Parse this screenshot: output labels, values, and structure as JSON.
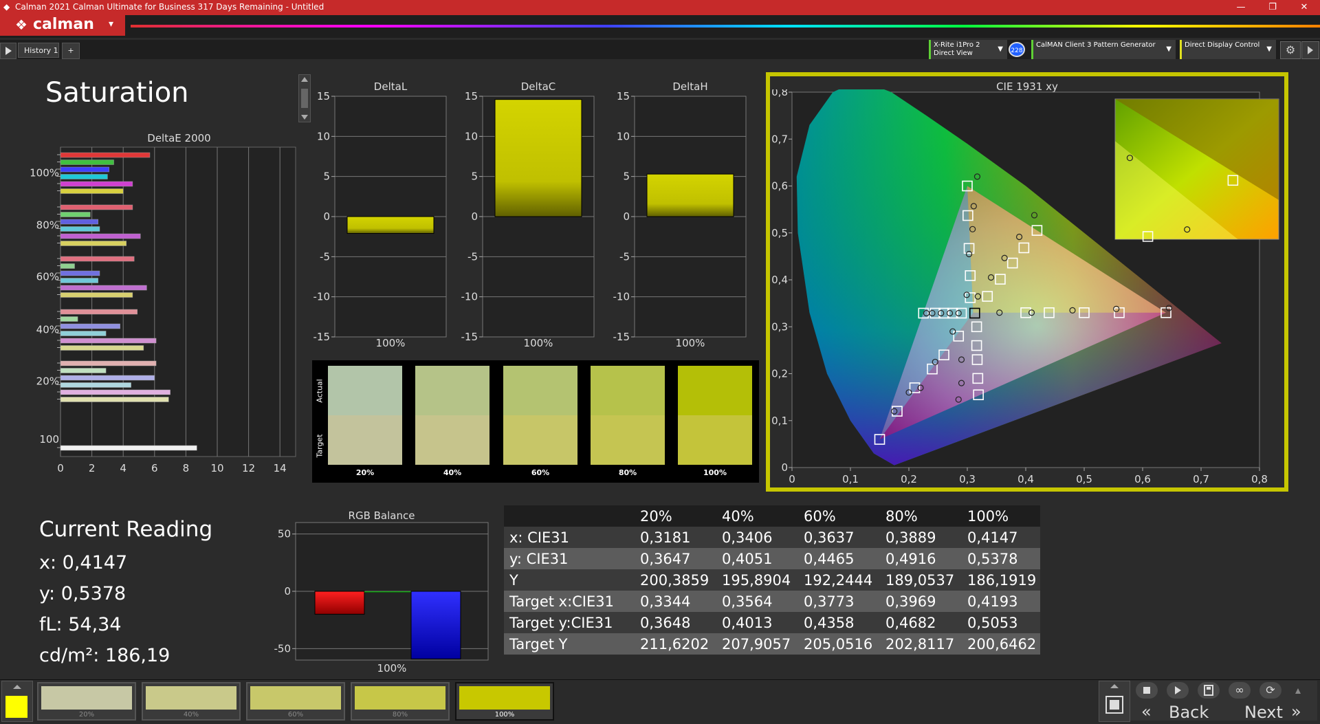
{
  "window": {
    "title": "Calman 2021 Calman Ultimate for Business 317 Days Remaining  -  Untitled",
    "minimize": "—",
    "restore": "❐",
    "close": "✕"
  },
  "header": {
    "logo_text": "calman",
    "logo_menu": "▾"
  },
  "tabs": [
    {
      "label": "History 1"
    },
    {
      "label": "+"
    }
  ],
  "devices": [
    {
      "line1": "X-Rite i1Pro 2",
      "line2": "Direct View",
      "badge": "228"
    },
    {
      "line1": "CalMAN Client 3 Pattern Generator",
      "line2": ""
    },
    {
      "line1": "Direct Display Control",
      "line2": ""
    }
  ],
  "page_title": "Saturation",
  "deltaE_chart": {
    "title": "DeltaE 2000",
    "y_labels": [
      "100%",
      "80%",
      "60%",
      "40%",
      "20%",
      "100"
    ],
    "x_ticks": [
      "0",
      "2",
      "4",
      "6",
      "8",
      "10",
      "12",
      "14"
    ],
    "xlim": [
      0,
      15
    ],
    "groups": [
      {
        "values": [
          5.7,
          3.4,
          3.1,
          3.0,
          4.6,
          4.0
        ],
        "colors": [
          "#e03838",
          "#40c040",
          "#4040ff",
          "#20c8d8",
          "#d040d0",
          "#d8d040"
        ]
      },
      {
        "values": [
          4.6,
          1.9,
          2.4,
          2.5,
          5.1,
          4.2
        ],
        "colors": [
          "#e06070",
          "#70d070",
          "#6060e0",
          "#60c8d8",
          "#c060d0",
          "#d8d060"
        ]
      },
      {
        "values": [
          4.7,
          0.9,
          2.5,
          2.4,
          5.5,
          4.6
        ],
        "colors": [
          "#e07080",
          "#90d090",
          "#7070e0",
          "#70c8d8",
          "#c070d0",
          "#d8d070"
        ]
      },
      {
        "values": [
          4.9,
          1.1,
          3.8,
          2.9,
          6.1,
          5.3
        ],
        "colors": [
          "#e09098",
          "#a0d8a0",
          "#9090e0",
          "#90d0d8",
          "#d090d0",
          "#d8d890"
        ]
      },
      {
        "values": [
          6.1,
          2.9,
          6.0,
          4.5,
          7.0,
          6.9
        ],
        "colors": [
          "#e0b0b0",
          "#c0e0c0",
          "#b0b0e8",
          "#b0d8e0",
          "#e0b0e0",
          "#e0e0b0"
        ]
      },
      {
        "values": [
          8.7
        ],
        "colors": [
          "#f0f0f0"
        ]
      }
    ]
  },
  "delta_charts": [
    {
      "title": "DeltaL",
      "value": -2.1,
      "xlabel": "100%",
      "y_ticks": [
        "15",
        "10",
        "5",
        "0",
        "-5",
        "-10",
        "-15"
      ]
    },
    {
      "title": "DeltaC",
      "value": 14.6,
      "xlabel": "100%",
      "y_ticks": [
        "15",
        "10",
        "5",
        "0",
        "-5",
        "-10",
        "-15"
      ]
    },
    {
      "title": "DeltaH",
      "value": 5.3,
      "xlabel": "100%",
      "y_ticks": [
        "15",
        "10",
        "5",
        "0",
        "-5",
        "-10",
        "-15"
      ]
    }
  ],
  "swatches": {
    "actual_label": "Actual",
    "target_label": "Target",
    "items": [
      {
        "label": "20%",
        "actual": "#b2c5a9",
        "target": "#c3c39c"
      },
      {
        "label": "40%",
        "actual": "#b5c388",
        "target": "#c6c48c"
      },
      {
        "label": "60%",
        "actual": "#b4c371",
        "target": "#c7c668"
      },
      {
        "label": "80%",
        "actual": "#b6c24b",
        "target": "#c5c552"
      },
      {
        "label": "100%",
        "actual": "#b4bf07",
        "target": "#c4c43a"
      }
    ]
  },
  "cie": {
    "title": "CIE 1931 xy",
    "x_ticks": [
      "0",
      "0,1",
      "0,2",
      "0,3",
      "0,4",
      "0,5",
      "0,6",
      "0,7",
      "0,8"
    ],
    "y_ticks": [
      "0",
      "0,1",
      "0,2",
      "0,3",
      "0,4",
      "0,5",
      "0,6",
      "0,7",
      "0,8"
    ],
    "xlim": [
      0,
      0.8
    ],
    "ylim": [
      0,
      0.8
    ],
    "gamut": [
      [
        0.64,
        0.33
      ],
      [
        0.3,
        0.6
      ],
      [
        0.15,
        0.06
      ]
    ],
    "white": [
      0.3127,
      0.329
    ],
    "targets": [
      [
        0.3344,
        0.3648
      ],
      [
        0.3564,
        0.4013
      ],
      [
        0.3773,
        0.4358
      ],
      [
        0.3969,
        0.4682
      ],
      [
        0.4193,
        0.5053
      ],
      [
        0.305,
        0.362
      ],
      [
        0.305,
        0.409
      ],
      [
        0.303,
        0.467
      ],
      [
        0.301,
        0.537
      ],
      [
        0.3,
        0.6
      ],
      [
        0.225,
        0.329
      ],
      [
        0.245,
        0.329
      ],
      [
        0.26,
        0.329
      ],
      [
        0.275,
        0.329
      ],
      [
        0.29,
        0.329
      ],
      [
        0.4,
        0.33
      ],
      [
        0.44,
        0.33
      ],
      [
        0.5,
        0.33
      ],
      [
        0.56,
        0.33
      ],
      [
        0.64,
        0.33
      ],
      [
        0.285,
        0.28
      ],
      [
        0.26,
        0.24
      ],
      [
        0.24,
        0.21
      ],
      [
        0.21,
        0.17
      ],
      [
        0.18,
        0.12
      ],
      [
        0.15,
        0.06
      ],
      [
        0.316,
        0.3
      ],
      [
        0.316,
        0.26
      ],
      [
        0.317,
        0.23
      ],
      [
        0.318,
        0.19
      ],
      [
        0.319,
        0.155
      ]
    ],
    "actuals": [
      [
        0.3181,
        0.3647
      ],
      [
        0.3406,
        0.4051
      ],
      [
        0.3637,
        0.4465
      ],
      [
        0.3889,
        0.4916
      ],
      [
        0.4147,
        0.5378
      ],
      [
        0.299,
        0.368
      ],
      [
        0.303,
        0.455
      ],
      [
        0.309,
        0.508
      ],
      [
        0.311,
        0.557
      ],
      [
        0.317,
        0.62
      ],
      [
        0.23,
        0.329
      ],
      [
        0.24,
        0.329
      ],
      [
        0.255,
        0.329
      ],
      [
        0.27,
        0.329
      ],
      [
        0.285,
        0.329
      ],
      [
        0.355,
        0.33
      ],
      [
        0.41,
        0.33
      ],
      [
        0.48,
        0.335
      ],
      [
        0.555,
        0.338
      ],
      [
        0.645,
        0.34
      ],
      [
        0.275,
        0.29
      ],
      [
        0.245,
        0.225
      ],
      [
        0.22,
        0.17
      ],
      [
        0.2,
        0.16
      ],
      [
        0.175,
        0.12
      ],
      [
        0.29,
        0.23
      ],
      [
        0.29,
        0.18
      ],
      [
        0.285,
        0.145
      ]
    ],
    "inset_targets": [
      [
        0.72,
        0.42
      ],
      [
        0.2,
        0.02
      ]
    ],
    "inset_actuals": [
      [
        0.44,
        0.07
      ],
      [
        0.09,
        0.58
      ]
    ]
  },
  "current_reading": {
    "title": "Current Reading",
    "x": "x: 0,4147",
    "y": "y: 0,5378",
    "fl": "fL: 54,34",
    "cdm2": "cd/m²: 186,19"
  },
  "rgb_balance": {
    "title": "RGB Balance",
    "y_ticks": [
      "50",
      "0",
      "-50"
    ],
    "xlabel": "100%",
    "ylim": [
      -60,
      60
    ],
    "red": -20,
    "green": -1,
    "blue": -59
  },
  "table": {
    "headers": [
      "",
      "20%",
      "40%",
      "60%",
      "80%",
      "100%"
    ],
    "rows": [
      [
        "x: CIE31",
        "0,3181",
        "0,3406",
        "0,3637",
        "0,3889",
        "0,4147"
      ],
      [
        "y: CIE31",
        "0,3647",
        "0,4051",
        "0,4465",
        "0,4916",
        "0,5378"
      ],
      [
        "Y",
        "200,3859",
        "195,8904",
        "192,2444",
        "189,0537",
        "186,1919"
      ],
      [
        "Target x:CIE31",
        "0,3344",
        "0,3564",
        "0,3773",
        "0,3969",
        "0,4193"
      ],
      [
        "Target y:CIE31",
        "0,3648",
        "0,4013",
        "0,4358",
        "0,4682",
        "0,5053"
      ],
      [
        "Target Y",
        "211,6202",
        "207,9057",
        "205,0516",
        "202,8117",
        "200,6462"
      ]
    ]
  },
  "bottom": {
    "current_color": "#ffff00",
    "patches": [
      {
        "label": "20%",
        "color": "#c7c8a5"
      },
      {
        "label": "40%",
        "color": "#c9c98a"
      },
      {
        "label": "60%",
        "color": "#c8c86a"
      },
      {
        "label": "80%",
        "color": "#c7c748"
      },
      {
        "label": "100%",
        "color": "#c8c800"
      }
    ],
    "back_label": "Back",
    "next_label": "Next"
  }
}
